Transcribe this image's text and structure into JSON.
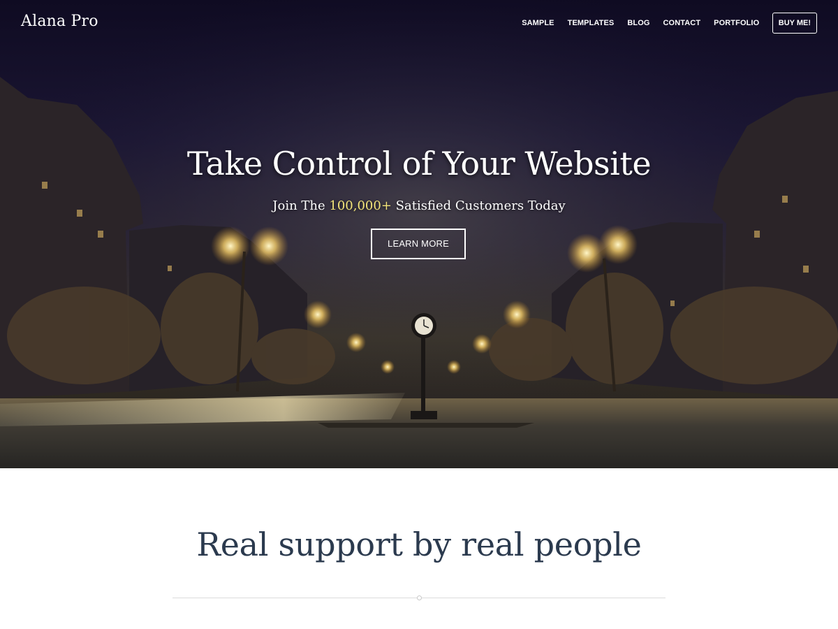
{
  "brand": {
    "name": "Alana Pro"
  },
  "nav": {
    "items": [
      "SAMPLE",
      "TEMPLATES",
      "BLOG",
      "CONTACT",
      "PORTFOLIO"
    ],
    "cta_label": "BUY ME!"
  },
  "hero": {
    "title": "Take Control of Your Website",
    "subtitle_prefix": "Join The ",
    "subtitle_highlight": "100,000+",
    "subtitle_suffix": " Satisfied Customers Today",
    "button_label": "LEARN MORE",
    "highlight_color": "#f3e47a",
    "background_image": "night-city-boulevard-photo"
  },
  "section": {
    "title": "Real support by real people"
  },
  "colors": {
    "heading": "#2b3a4e",
    "divider": "#dcdcdc"
  }
}
